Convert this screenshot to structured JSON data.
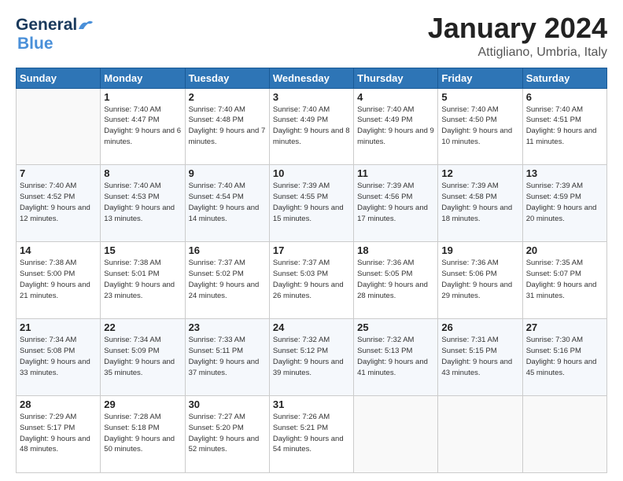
{
  "header": {
    "logo": {
      "line1": "General",
      "line2": "Blue",
      "tagline": ""
    },
    "title": "January 2024",
    "subtitle": "Attigliano, Umbria, Italy"
  },
  "calendar": {
    "days_of_week": [
      "Sunday",
      "Monday",
      "Tuesday",
      "Wednesday",
      "Thursday",
      "Friday",
      "Saturday"
    ],
    "weeks": [
      [
        {
          "day": "",
          "info": ""
        },
        {
          "day": "1",
          "info": "Sunrise: 7:40 AM\nSunset: 4:47 PM\nDaylight: 9 hours\nand 6 minutes."
        },
        {
          "day": "2",
          "info": "Sunrise: 7:40 AM\nSunset: 4:48 PM\nDaylight: 9 hours\nand 7 minutes."
        },
        {
          "day": "3",
          "info": "Sunrise: 7:40 AM\nSunset: 4:49 PM\nDaylight: 9 hours\nand 8 minutes."
        },
        {
          "day": "4",
          "info": "Sunrise: 7:40 AM\nSunset: 4:49 PM\nDaylight: 9 hours\nand 9 minutes."
        },
        {
          "day": "5",
          "info": "Sunrise: 7:40 AM\nSunset: 4:50 PM\nDaylight: 9 hours\nand 10 minutes."
        },
        {
          "day": "6",
          "info": "Sunrise: 7:40 AM\nSunset: 4:51 PM\nDaylight: 9 hours\nand 11 minutes."
        }
      ],
      [
        {
          "day": "7",
          "info": "Sunrise: 7:40 AM\nSunset: 4:52 PM\nDaylight: 9 hours\nand 12 minutes."
        },
        {
          "day": "8",
          "info": "Sunrise: 7:40 AM\nSunset: 4:53 PM\nDaylight: 9 hours\nand 13 minutes."
        },
        {
          "day": "9",
          "info": "Sunrise: 7:40 AM\nSunset: 4:54 PM\nDaylight: 9 hours\nand 14 minutes."
        },
        {
          "day": "10",
          "info": "Sunrise: 7:39 AM\nSunset: 4:55 PM\nDaylight: 9 hours\nand 15 minutes."
        },
        {
          "day": "11",
          "info": "Sunrise: 7:39 AM\nSunset: 4:56 PM\nDaylight: 9 hours\nand 17 minutes."
        },
        {
          "day": "12",
          "info": "Sunrise: 7:39 AM\nSunset: 4:58 PM\nDaylight: 9 hours\nand 18 minutes."
        },
        {
          "day": "13",
          "info": "Sunrise: 7:39 AM\nSunset: 4:59 PM\nDaylight: 9 hours\nand 20 minutes."
        }
      ],
      [
        {
          "day": "14",
          "info": "Sunrise: 7:38 AM\nSunset: 5:00 PM\nDaylight: 9 hours\nand 21 minutes."
        },
        {
          "day": "15",
          "info": "Sunrise: 7:38 AM\nSunset: 5:01 PM\nDaylight: 9 hours\nand 23 minutes."
        },
        {
          "day": "16",
          "info": "Sunrise: 7:37 AM\nSunset: 5:02 PM\nDaylight: 9 hours\nand 24 minutes."
        },
        {
          "day": "17",
          "info": "Sunrise: 7:37 AM\nSunset: 5:03 PM\nDaylight: 9 hours\nand 26 minutes."
        },
        {
          "day": "18",
          "info": "Sunrise: 7:36 AM\nSunset: 5:05 PM\nDaylight: 9 hours\nand 28 minutes."
        },
        {
          "day": "19",
          "info": "Sunrise: 7:36 AM\nSunset: 5:06 PM\nDaylight: 9 hours\nand 29 minutes."
        },
        {
          "day": "20",
          "info": "Sunrise: 7:35 AM\nSunset: 5:07 PM\nDaylight: 9 hours\nand 31 minutes."
        }
      ],
      [
        {
          "day": "21",
          "info": "Sunrise: 7:34 AM\nSunset: 5:08 PM\nDaylight: 9 hours\nand 33 minutes."
        },
        {
          "day": "22",
          "info": "Sunrise: 7:34 AM\nSunset: 5:09 PM\nDaylight: 9 hours\nand 35 minutes."
        },
        {
          "day": "23",
          "info": "Sunrise: 7:33 AM\nSunset: 5:11 PM\nDaylight: 9 hours\nand 37 minutes."
        },
        {
          "day": "24",
          "info": "Sunrise: 7:32 AM\nSunset: 5:12 PM\nDaylight: 9 hours\nand 39 minutes."
        },
        {
          "day": "25",
          "info": "Sunrise: 7:32 AM\nSunset: 5:13 PM\nDaylight: 9 hours\nand 41 minutes."
        },
        {
          "day": "26",
          "info": "Sunrise: 7:31 AM\nSunset: 5:15 PM\nDaylight: 9 hours\nand 43 minutes."
        },
        {
          "day": "27",
          "info": "Sunrise: 7:30 AM\nSunset: 5:16 PM\nDaylight: 9 hours\nand 45 minutes."
        }
      ],
      [
        {
          "day": "28",
          "info": "Sunrise: 7:29 AM\nSunset: 5:17 PM\nDaylight: 9 hours\nand 48 minutes."
        },
        {
          "day": "29",
          "info": "Sunrise: 7:28 AM\nSunset: 5:18 PM\nDaylight: 9 hours\nand 50 minutes."
        },
        {
          "day": "30",
          "info": "Sunrise: 7:27 AM\nSunset: 5:20 PM\nDaylight: 9 hours\nand 52 minutes."
        },
        {
          "day": "31",
          "info": "Sunrise: 7:26 AM\nSunset: 5:21 PM\nDaylight: 9 hours\nand 54 minutes."
        },
        {
          "day": "",
          "info": ""
        },
        {
          "day": "",
          "info": ""
        },
        {
          "day": "",
          "info": ""
        }
      ]
    ]
  }
}
